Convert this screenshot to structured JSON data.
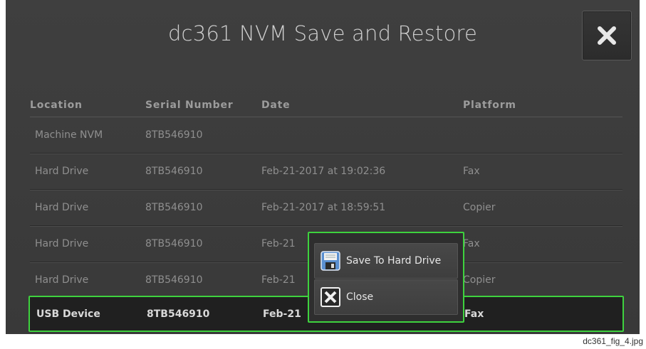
{
  "window": {
    "title": "dc361 NVM Save and Restore"
  },
  "table": {
    "columns": [
      "Location",
      "Serial Number",
      "Date",
      "Platform"
    ],
    "rows": [
      {
        "location": "Machine NVM",
        "serial": "8TB546910",
        "date": "",
        "platform": ""
      },
      {
        "location": "Hard Drive",
        "serial": "8TB546910",
        "date": "Feb-21-2017 at 19:02:36",
        "platform": "Fax"
      },
      {
        "location": "Hard Drive",
        "serial": "8TB546910",
        "date": "Feb-21-2017 at 18:59:51",
        "platform": "Copier"
      },
      {
        "location": "Hard Drive",
        "serial": "8TB546910",
        "date": "Feb-21",
        "platform": "Fax"
      },
      {
        "location": "Hard Drive",
        "serial": "8TB546910",
        "date": "Feb-21",
        "platform": "Copier"
      },
      {
        "location": "USB Device",
        "serial": "8TB546910",
        "date": "Feb-21",
        "platform": "Fax",
        "selected": true
      }
    ]
  },
  "popup": {
    "items": [
      {
        "label": "Save To Hard Drive",
        "icon": "floppy-disk-icon"
      },
      {
        "label": "Close",
        "icon": "close-box-icon"
      }
    ]
  },
  "caption": "dc361_fig_4.jpg",
  "colors": {
    "background": "#3d3d3d",
    "selection_outline": "#3ed23e",
    "text_dim": "#8f8f8f",
    "text_bright": "#d9d9d9"
  }
}
